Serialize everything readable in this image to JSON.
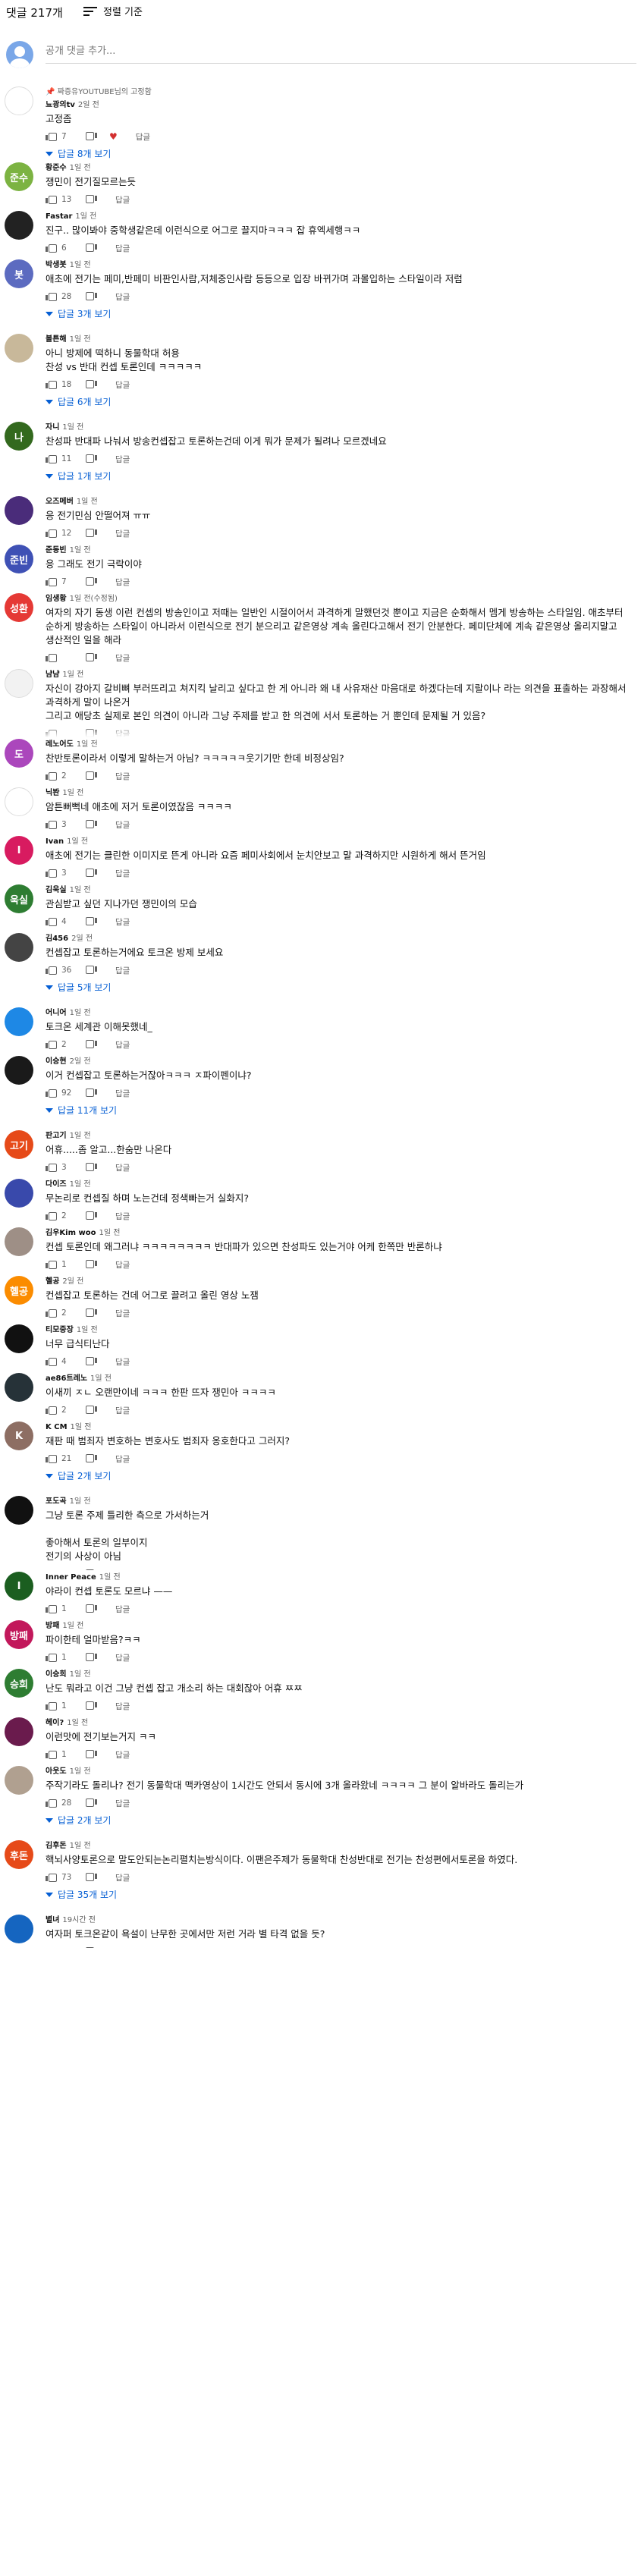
{
  "header": {
    "count": "댓글 217개",
    "sort_label": "정렬 기준"
  },
  "add_comment": {
    "placeholder": "공개 댓글 추가..."
  },
  "labels": {
    "reply": "답글",
    "pinned_prefix": "📌 짜증유YOUTUBE님의 고정함"
  },
  "comments": [
    {
      "author": "뇨광의tv",
      "time": "2일 전",
      "text": "고정좀",
      "likes": "7",
      "heart": true,
      "replies": "답글 8개 보기",
      "avatar_bg": "#ffffff",
      "avatar_text": "",
      "h": 100,
      "pinned": true
    },
    {
      "author": "황준수",
      "time": "1일 전",
      "text": "쟁민이 전기질모르는듯",
      "likes": "13",
      "heart": false,
      "replies": "",
      "avatar_bg": "#7cb342",
      "avatar_text": "준수",
      "h": 64
    },
    {
      "author": "Fastar",
      "time": "1일 전",
      "text": "진구.. 많이봐야 중학생같은데 이런식으로 어그로 끌지마ㅋㅋㅋ 잡 휴엑세행ㅋㅋ",
      "likes": "6",
      "heart": false,
      "replies": "",
      "avatar_bg": "#222222",
      "avatar_text": "",
      "h": 64
    },
    {
      "author": "박생봇",
      "time": "1일 전",
      "text": "애초에 전기는 페미,반페미 비판인사람,저체중인사람 등등으로 입장 바뀌가며 과몰입하는 스타일이라 저럼",
      "likes": "28",
      "heart": false,
      "replies": "답글 3개 보기",
      "avatar_bg": "#5c6bc0",
      "avatar_text": "봇",
      "h": 98
    },
    {
      "author": "볼튼해",
      "time": "1일 전",
      "text": "아니 방제에 떡하니 동물학대 허용\n찬성 vs 반대 컨셉 토론인데 ㅋㅋㅋㅋㅋ",
      "likes": "18",
      "heart": false,
      "replies": "답글 6개 보기",
      "avatar_bg": "#c8b89a",
      "avatar_text": "",
      "h": 116
    },
    {
      "author": "자니",
      "time": "1일 전",
      "text": "찬성파 반대파 나눠서 방송컨셉잡고 토론하는건데 이게 뭐가 문제가 될려나 모르겠네요",
      "likes": "11",
      "heart": false,
      "replies": "답글 1개 보기",
      "avatar_bg": "#33691e",
      "avatar_text": "나",
      "h": 98
    },
    {
      "author": "오즈메버",
      "time": "1일 전",
      "text": "응 전기민심 안떨어져 ㅠㅠ",
      "likes": "12",
      "heart": false,
      "replies": "",
      "avatar_bg": "#4a2c7a",
      "avatar_text": "",
      "h": 64
    },
    {
      "author": "준동빈",
      "time": "1일 전",
      "text": "응 그래도 전기 극락이야",
      "likes": "7",
      "heart": false,
      "replies": "",
      "avatar_bg": "#3f51b5",
      "avatar_text": "준빈",
      "h": 64
    },
    {
      "author": "임생황",
      "time": "1일 전(수정됨)",
      "text": "여자의 자기 동생 이런 컨셉의 방송인이고 저때는 일반인 시절이어서 과격하게 말했던것 뿐이고 지금은 순화해서 멤게 방송하는 스타일임. 애초부터 순하게 방송하는 스타일이 아니라서 이런식으로 전기 분으리고 같은영상 계속 올린다고해서 전기 안분한다. 페미단체에 계속 같은영상 올리지말고 생산적인 일을 해라",
      "likes": "",
      "heart": false,
      "replies": "",
      "avatar_bg": "#e53935",
      "avatar_text": "성환",
      "h": 100
    },
    {
      "author": "냠냠",
      "time": "1일 전",
      "text": "자신이 강아지 갈비뼈 부러뜨리고 쳐지킥 날리고 싶다고 한 게 아니라 왜 내 사유재산 마음대로 하겠다는데 지랄이나 라는 의견을 표출하는 과장해서 과격하게 말이 나온거\n그리고 애당초 실제로 본인 의견이 아니라 그냥 주제를 받고 한 의견에 서서 토론하는 거 뿐인데 문제될 거 있음?",
      "likes": "",
      "heart": false,
      "replies": "",
      "avatar_bg": "#f2f2f2",
      "avatar_text": "",
      "h": 92
    },
    {
      "author": "레노어도",
      "time": "1일 전",
      "text": "찬반토론이라서 이렇게 말하는거 아님? ㅋㅋㅋㅋㅋ웃기기만 한데 비정상임?",
      "likes": "2",
      "heart": false,
      "replies": "",
      "avatar_bg": "#ab47bc",
      "avatar_text": "도",
      "h": 64
    },
    {
      "author": "닉봔",
      "time": "1일 전",
      "text": "암튼뻐뻑네 애초에 저거 토론이였잖음 ㅋㅋㅋㅋ",
      "likes": "3",
      "heart": false,
      "replies": "",
      "avatar_bg": "#ffffff",
      "avatar_text": "",
      "h": 64
    },
    {
      "author": "Ivan",
      "time": "1일 전",
      "text": "애초에 전기는 클린한 이미지로 뜬게 아니라 요즘 페미사회에서 눈치안보고 말 과격하지만 시원하게 해서 뜬거임",
      "likes": "3",
      "heart": false,
      "replies": "",
      "avatar_bg": "#d81b60",
      "avatar_text": "I",
      "h": 64
    },
    {
      "author": "김욱실",
      "time": "1일 전",
      "text": "관심받고 싶던 지나가던 쟁민이의 모습",
      "likes": "4",
      "heart": false,
      "replies": "",
      "avatar_bg": "#2e7d32",
      "avatar_text": "욱실",
      "h": 64
    },
    {
      "author": "김456",
      "time": "2일 전",
      "text": "컨셉잡고 토론하는거에요 토크온 방제 보세요",
      "likes": "36",
      "heart": false,
      "replies": "답글 5개 보기",
      "avatar_bg": "#444444",
      "avatar_text": "",
      "h": 98
    },
    {
      "author": "어니어",
      "time": "1일 전",
      "text": "토크온 세계관 이해못했네_",
      "likes": "2",
      "heart": false,
      "replies": "",
      "avatar_bg": "#1e88e5",
      "avatar_text": "",
      "h": 64
    },
    {
      "author": "이승현",
      "time": "2일 전",
      "text": "이거 컨셉잡고 토론하는거잖아ㅋㅋㅋ ㅈ파이펜이냐?",
      "likes": "92",
      "heart": false,
      "replies": "답글 11개 보기",
      "avatar_bg": "#1a1a1a",
      "avatar_text": "",
      "h": 98
    },
    {
      "author": "판고기",
      "time": "1일 전",
      "text": "어휴.....좀 알고...한숨만 나온다",
      "likes": "3",
      "heart": false,
      "replies": "",
      "avatar_bg": "#e64a19",
      "avatar_text": "고기",
      "h": 64
    },
    {
      "author": "다이즈",
      "time": "1일 전",
      "text": "무논리로 컨셉질 하며 노는건데 정색빠는거 실화지?",
      "likes": "2",
      "heart": false,
      "replies": "",
      "avatar_bg": "#3949ab",
      "avatar_text": "",
      "h": 64
    },
    {
      "author": "김우Kim woo",
      "time": "1일 전",
      "text": "컨셉 토론인데 왜그러냐 ㅋㅋㅋㅋㅋㅋㅋㅋ 반대파가 있으면 찬성파도 있는거야 어케 한쪽만 반론하냐",
      "likes": "1",
      "heart": false,
      "replies": "",
      "avatar_bg": "#9e8f86",
      "avatar_text": "",
      "h": 64
    },
    {
      "author": "혤공",
      "time": "2일 전",
      "text": "컨셉잡고 토론하는 건데 어그로 끌려고 올린 영상 노잼",
      "likes": "2",
      "heart": false,
      "replies": "",
      "avatar_bg": "#fb8c00",
      "avatar_text": "혤공",
      "h": 64
    },
    {
      "author": "티모중장",
      "time": "1일 전",
      "text": "너무 급식티난다",
      "likes": "4",
      "heart": false,
      "replies": "",
      "avatar_bg": "#111111",
      "avatar_text": "",
      "h": 64
    },
    {
      "author": "ae86트레노",
      "time": "1일 전",
      "text": "이새끼 ㅈㄴ 오랜만이네 ㅋㅋㅋ 한판 뜨자 쟁민아 ㅋㅋㅋㅋ",
      "likes": "2",
      "heart": false,
      "replies": "",
      "avatar_bg": "#263238",
      "avatar_text": "",
      "h": 64
    },
    {
      "author": "K CM",
      "time": "1일 전",
      "text": "재판 때 범죄자 변호하는 변호사도 범죄자 옹호한다고 그러지?",
      "likes": "21",
      "heart": false,
      "replies": "답글 2개 보기",
      "avatar_bg": "#8d6e63",
      "avatar_text": "K",
      "h": 98
    },
    {
      "author": "포도곡",
      "time": "1일 전",
      "text": "그냥 토론 주제 틀리한 측으로 가서하는거\n\n좋아해서 토론의 일부이지\n전기의 사상이 아님",
      "likes": "1",
      "heart": false,
      "replies": "",
      "avatar_bg": "#111111",
      "avatar_text": "",
      "h": 100
    },
    {
      "author": "Inner Peace",
      "time": "1일 전",
      "text": "야라이 컨셉 토론도 모르냐 ——",
      "likes": "1",
      "heart": false,
      "replies": "",
      "avatar_bg": "#1b5e20",
      "avatar_text": "I",
      "h": 64
    },
    {
      "author": "방패",
      "time": "1일 전",
      "text": "파이한테 얼마받음?ㅋㅋ",
      "likes": "1",
      "heart": false,
      "replies": "",
      "avatar_bg": "#c2185b",
      "avatar_text": "방패",
      "h": 64
    },
    {
      "author": "이승희",
      "time": "1일 전",
      "text": "난도 뭐라고 이건 그냥 컨셉 잡고 개소리 하는 대회잖아 어휴 ㅉㅉ",
      "likes": "1",
      "heart": false,
      "replies": "",
      "avatar_bg": "#2e7d32",
      "avatar_text": "승희",
      "h": 64
    },
    {
      "author": "헤이?",
      "time": "1일 전",
      "text": "이런맛에 전기보는거지 ㅋㅋ",
      "likes": "1",
      "heart": false,
      "replies": "",
      "avatar_bg": "#6a1b4d",
      "avatar_text": "",
      "h": 64
    },
    {
      "author": "아웃도",
      "time": "1일 전",
      "text": "주작기라도 돌리나? 전기 동물학대 맥카영상이 1시간도 안되서 동시에 3개 올라왔네 ㅋㅋㅋㅋ 그 분이 알바라도 돌리는가",
      "likes": "28",
      "heart": false,
      "replies": "답글 2개 보기",
      "avatar_bg": "#b0a090",
      "avatar_text": "",
      "h": 98
    },
    {
      "author": "김후돈",
      "time": "1일 전",
      "text": "핵뇌사양토론으로 말도안되는논리펼치는방식이다. 이팬은주제가 동물학대 찬성반대로 전기는 찬성편에서토론을 하였다.",
      "likes": "73",
      "heart": false,
      "replies": "답글 35개 보기",
      "avatar_bg": "#e64a19",
      "avatar_text": "후돈",
      "h": 98
    },
    {
      "author": "별녀",
      "time": "19시간 전",
      "text": "여자퍼 토크온같이 욕설이 난무한 곳에서만 저런 거라 별 타격 없을 듯?",
      "likes": "",
      "heart": false,
      "replies": "",
      "avatar_bg": "#1565c0",
      "avatar_text": "",
      "h": 46
    }
  ]
}
